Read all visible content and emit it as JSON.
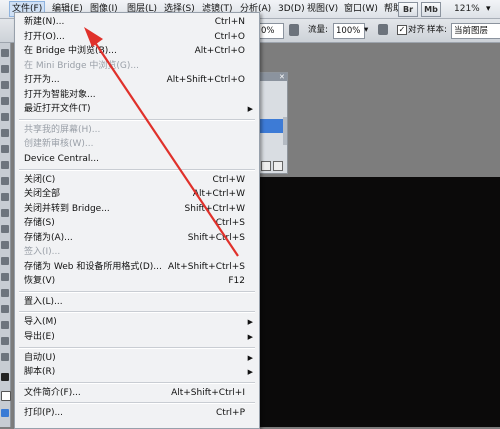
{
  "menubar": {
    "items": [
      "文件(F)",
      "编辑(E)",
      "图像(I)",
      "图层(L)",
      "选择(S)",
      "滤镜(T)",
      "分析(A)",
      "3D(D)",
      "视图(V)",
      "窗口(W)",
      "帮助(H)"
    ],
    "btn_br": "Br",
    "btn_mb": "Mb",
    "zoom": "121%"
  },
  "options": {
    "left_value": "0%",
    "flow_label": "流量:",
    "flow_value": "100%",
    "align_label": "对齐",
    "sample_label": "样本:",
    "sample_value": "当前图层"
  },
  "file_menu": {
    "items": [
      {
        "label": "新建(N)...",
        "shortcut": "Ctrl+N"
      },
      {
        "label": "打开(O)...",
        "shortcut": "Ctrl+O"
      },
      {
        "label": "在 Bridge 中浏览(B)...",
        "shortcut": "Alt+Ctrl+O"
      },
      {
        "label": "在 Mini Bridge 中浏览(G)...",
        "disabled": true
      },
      {
        "label": "打开为...",
        "shortcut": "Alt+Shift+Ctrl+O"
      },
      {
        "label": "打开为智能对象..."
      },
      {
        "label": "最近打开文件(T)",
        "submenu": true
      },
      {
        "separator": true
      },
      {
        "label": "共享我的屏幕(H)...",
        "disabled": true
      },
      {
        "label": "创建新审核(W)...",
        "disabled": true
      },
      {
        "label": "Device Central..."
      },
      {
        "separator": true
      },
      {
        "label": "关闭(C)",
        "shortcut": "Ctrl+W"
      },
      {
        "label": "关闭全部",
        "shortcut": "Alt+Ctrl+W"
      },
      {
        "label": "关闭并转到 Bridge...",
        "shortcut": "Shift+Ctrl+W"
      },
      {
        "label": "存储(S)",
        "shortcut": "Ctrl+S"
      },
      {
        "label": "存储为(A)...",
        "shortcut": "Shift+Ctrl+S"
      },
      {
        "label": "签入(I)...",
        "disabled": true
      },
      {
        "label": "存储为 Web 和设备所用格式(D)...",
        "shortcut": "Alt+Shift+Ctrl+S"
      },
      {
        "label": "恢复(V)",
        "shortcut": "F12"
      },
      {
        "separator": true
      },
      {
        "label": "置入(L)..."
      },
      {
        "separator": true
      },
      {
        "label": "导入(M)",
        "submenu": true
      },
      {
        "label": "导出(E)",
        "submenu": true
      },
      {
        "separator": true
      },
      {
        "label": "自动(U)",
        "submenu": true
      },
      {
        "label": "脚本(R)",
        "submenu": true
      },
      {
        "separator": true
      },
      {
        "label": "文件简介(F)...",
        "shortcut": "Alt+Shift+Ctrl+I"
      },
      {
        "separator": true
      },
      {
        "label": "打印(P)...",
        "shortcut": "Ctrl+P"
      }
    ]
  },
  "colors": {
    "menu_bg": "#f1f2f4",
    "disabled_text": "#9aa0a8",
    "annotation_arrow": "#e0312b",
    "jersey": "#e9e4e6",
    "jersey_trim": "#c8243a"
  },
  "icons": [
    "close-icon",
    "submenu-arrow-icon",
    "checkbox-icon"
  ]
}
